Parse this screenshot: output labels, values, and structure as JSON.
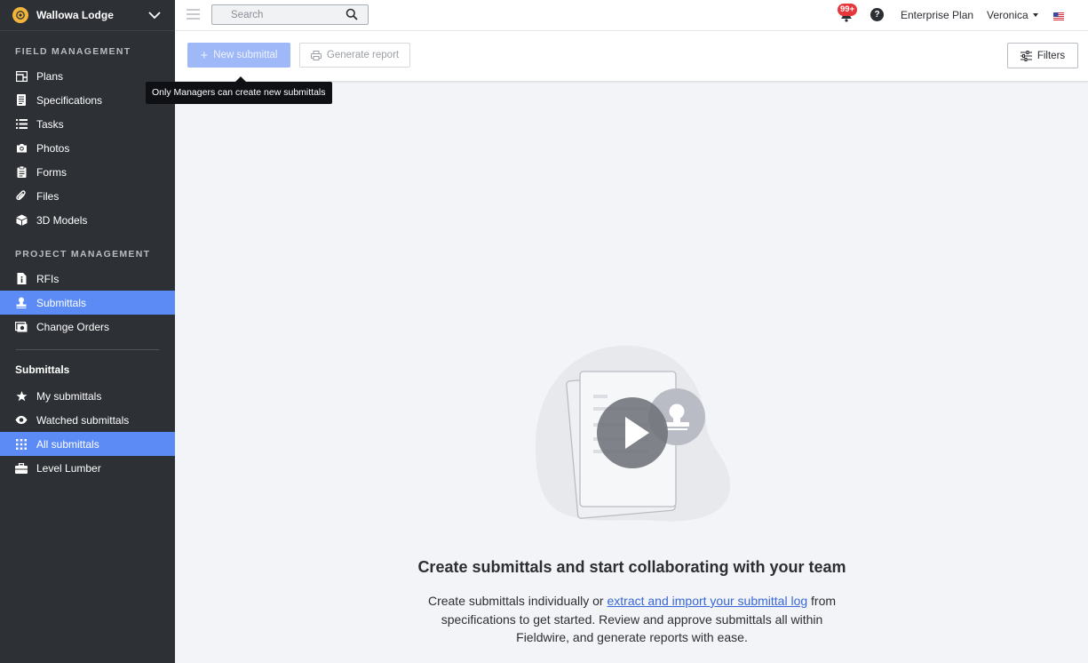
{
  "sidebar": {
    "project_name": "Wallowa Lodge",
    "sections": [
      {
        "title": "FIELD MANAGEMENT",
        "items": [
          {
            "label": "Plans",
            "icon": "plans-icon"
          },
          {
            "label": "Specifications",
            "icon": "specifications-icon"
          },
          {
            "label": "Tasks",
            "icon": "tasks-list-icon"
          },
          {
            "label": "Photos",
            "icon": "camera-icon"
          },
          {
            "label": "Forms",
            "icon": "clipboard-icon"
          },
          {
            "label": "Files",
            "icon": "paperclip-icon"
          },
          {
            "label": "3D Models",
            "icon": "cube-icon"
          }
        ]
      },
      {
        "title": "PROJECT MANAGEMENT",
        "items": [
          {
            "label": "RFIs",
            "icon": "rfi-document-icon"
          },
          {
            "label": "Submittals",
            "icon": "stamp-icon",
            "active": true
          },
          {
            "label": "Change Orders",
            "icon": "change-orders-icon"
          }
        ]
      }
    ],
    "submittals_heading": "Submittals",
    "submittal_views": [
      {
        "label": "My submittals",
        "icon": "star-icon"
      },
      {
        "label": "Watched submittals",
        "icon": "eye-icon"
      },
      {
        "label": "All submittals",
        "icon": "grid-icon",
        "active": true
      },
      {
        "label": "Level Lumber",
        "icon": "briefcase-icon"
      }
    ]
  },
  "topbar": {
    "search_placeholder": "Search",
    "notification_badge": "99+",
    "help_glyph": "?",
    "plan": "Enterprise Plan",
    "user": "Veronica"
  },
  "toolbar": {
    "new_submittal": "New submittal",
    "generate_report": "Generate report",
    "filters": "Filters",
    "tooltip": "Only Managers can create new submittals"
  },
  "empty_state": {
    "title": "Create submittals and start collaborating with your team",
    "desc_before": "Create submittals individually or ",
    "desc_link": "extract and import your submittal log",
    "desc_after": " from specifications to get started. Review and approve submittals all within Fieldwire, and generate reports with ease."
  },
  "colors": {
    "sidebar_bg": "#2d3035",
    "active_item": "#5c8bf5",
    "primary_disabled": "#9fb8f8",
    "badge": "#e8373c",
    "link": "#3867d6"
  }
}
